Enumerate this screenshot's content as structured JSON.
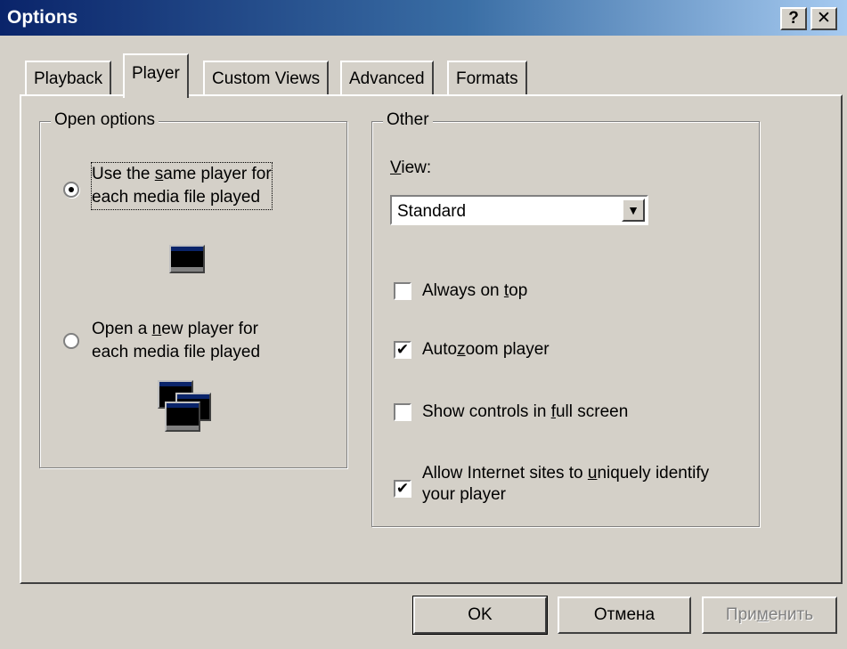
{
  "window": {
    "title": "Options",
    "help_label": "?",
    "close_label": "✕"
  },
  "tabs": [
    {
      "label": "Playback",
      "active": false
    },
    {
      "label": "Player",
      "active": true
    },
    {
      "label": "Custom Views",
      "active": false
    },
    {
      "label": "Advanced",
      "active": false
    },
    {
      "label": "Formats",
      "active": false
    }
  ],
  "open_options": {
    "legend": "Open options",
    "same_player": {
      "line1_pre": "Use the ",
      "line1_ul": "s",
      "line1_post": "ame player for",
      "line2": "each media file played",
      "selected": true
    },
    "new_player": {
      "line1_pre": "Open a ",
      "line1_ul": "n",
      "line1_post": "ew player for",
      "line2": "each media file played",
      "selected": false
    }
  },
  "other": {
    "legend": "Other",
    "view_label_ul": "V",
    "view_label_rest": "iew:",
    "view_value": "Standard",
    "always_on_top": {
      "pre": "Always on ",
      "ul": "t",
      "post": "op",
      "checked": false
    },
    "autozoom": {
      "pre": "Auto",
      "ul": "z",
      "post": "oom player",
      "checked": true
    },
    "show_controls": {
      "pre": "Show controls in ",
      "ul": "f",
      "post": "ull screen",
      "checked": false
    },
    "allow_internet": {
      "line1_pre": "Allow Internet sites to ",
      "line1_ul": "u",
      "line1_post": "niquely identify",
      "line2": "your player",
      "checked": true
    }
  },
  "buttons": {
    "ok": "OK",
    "cancel": "Отмена",
    "apply_pre": "При",
    "apply_ul": "м",
    "apply_post": "енить"
  }
}
